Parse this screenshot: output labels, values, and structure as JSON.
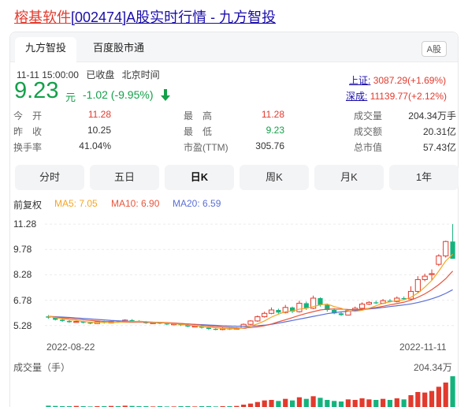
{
  "title": {
    "highlight": "榕基软件",
    "code": "[002474]",
    "rest": "A股实时行情 - 九方智投"
  },
  "tabs": [
    {
      "label": "九方智投",
      "active": true
    },
    {
      "label": "百度股市通",
      "active": false
    }
  ],
  "badge": "A股",
  "status": {
    "time": "11-11 15:00:00",
    "state": "已收盘",
    "zone": "北京时间"
  },
  "quote": {
    "price": "9.23",
    "unit": "元",
    "change": "-1.02 (-9.95%)",
    "color": "#14a04a"
  },
  "indices": [
    {
      "name": "上证:",
      "value": "3087.29(+1.69%)"
    },
    {
      "name": "深成:",
      "value": "11139.77(+2.12%)"
    }
  ],
  "stats": [
    [
      {
        "k": "今　开",
        "v": "11.28",
        "c": "red"
      },
      {
        "k": "最　高",
        "v": "11.28",
        "c": "red"
      },
      {
        "k": "成交量",
        "v": "204.34万手",
        "c": ""
      }
    ],
    [
      {
        "k": "昨　收",
        "v": "10.25",
        "c": ""
      },
      {
        "k": "最　低",
        "v": "9.23",
        "c": "green"
      },
      {
        "k": "成交额",
        "v": "20.31亿",
        "c": ""
      }
    ],
    [
      {
        "k": "换手率",
        "v": "41.04%",
        "c": ""
      },
      {
        "k": "市盈(TTM)",
        "v": "305.76",
        "c": ""
      },
      {
        "k": "总市值",
        "v": "57.43亿",
        "c": ""
      }
    ]
  ],
  "periods": [
    {
      "label": "分时",
      "active": false
    },
    {
      "label": "五日",
      "active": false
    },
    {
      "label": "日K",
      "active": true
    },
    {
      "label": "周K",
      "active": false
    },
    {
      "label": "月K",
      "active": false
    },
    {
      "label": "1年",
      "active": false
    }
  ],
  "ma_legend": {
    "adjust": "前复权",
    "ma5": "MA5: 7.05",
    "ma10": "MA10: 6.90",
    "ma20": "MA20: 6.59"
  },
  "colors": {
    "up": "#e23a2d",
    "down": "#14b37d",
    "ma5": "#f5a623",
    "ma10": "#e8553b",
    "ma20": "#5b6fd6"
  },
  "chart_data": {
    "type": "candlestick",
    "y_ticks": [
      "11.28",
      "9.78",
      "8.28",
      "6.78",
      "5.28"
    ],
    "ylim": [
      4.8,
      11.8
    ],
    "x_start": "2022-08-22",
    "x_end": "2022-11-11",
    "candles": [
      [
        5.82,
        5.75,
        5.9,
        5.68
      ],
      [
        5.75,
        5.62,
        5.8,
        5.58
      ],
      [
        5.62,
        5.55,
        5.68,
        5.5
      ],
      [
        5.55,
        5.48,
        5.6,
        5.44
      ],
      [
        5.48,
        5.52,
        5.58,
        5.45
      ],
      [
        5.52,
        5.45,
        5.56,
        5.4
      ],
      [
        5.45,
        5.4,
        5.5,
        5.36
      ],
      [
        5.4,
        5.5,
        5.55,
        5.38
      ],
      [
        5.5,
        5.44,
        5.56,
        5.4
      ],
      [
        5.44,
        5.52,
        5.58,
        5.42
      ],
      [
        5.52,
        5.48,
        5.58,
        5.44
      ],
      [
        5.48,
        5.6,
        5.65,
        5.46
      ],
      [
        5.6,
        5.55,
        5.66,
        5.5
      ],
      [
        5.55,
        5.5,
        5.6,
        5.46
      ],
      [
        5.5,
        5.42,
        5.55,
        5.38
      ],
      [
        5.42,
        5.45,
        5.5,
        5.38
      ],
      [
        5.45,
        5.4,
        5.5,
        5.36
      ],
      [
        5.4,
        5.35,
        5.45,
        5.3
      ],
      [
        5.35,
        5.38,
        5.42,
        5.3
      ],
      [
        5.38,
        5.3,
        5.42,
        5.25
      ],
      [
        5.3,
        5.22,
        5.35,
        5.18
      ],
      [
        5.22,
        5.25,
        5.3,
        5.18
      ],
      [
        5.25,
        5.15,
        5.28,
        5.1
      ],
      [
        5.15,
        5.08,
        5.2,
        5.02
      ],
      [
        5.08,
        5.05,
        5.12,
        5.0
      ],
      [
        5.05,
        5.1,
        5.15,
        5.0
      ],
      [
        5.1,
        5.08,
        5.15,
        5.02
      ],
      [
        5.08,
        5.12,
        5.18,
        5.04
      ],
      [
        5.12,
        5.35,
        5.4,
        5.1
      ],
      [
        5.35,
        5.55,
        5.6,
        5.3
      ],
      [
        5.55,
        5.8,
        5.88,
        5.5
      ],
      [
        5.8,
        6.0,
        6.1,
        5.75
      ],
      [
        6.0,
        6.2,
        6.35,
        5.95
      ],
      [
        6.2,
        6.05,
        6.28,
        5.98
      ],
      [
        6.05,
        6.35,
        6.5,
        6.0
      ],
      [
        6.35,
        6.1,
        6.4,
        6.02
      ],
      [
        6.1,
        6.6,
        6.75,
        6.05
      ],
      [
        6.6,
        6.3,
        6.7,
        6.2
      ],
      [
        6.3,
        6.9,
        7.05,
        6.25
      ],
      [
        6.9,
        6.5,
        6.95,
        6.4
      ],
      [
        6.5,
        6.2,
        6.58,
        6.1
      ],
      [
        6.2,
        6.0,
        6.3,
        5.95
      ],
      [
        6.0,
        5.9,
        6.1,
        5.85
      ],
      [
        5.9,
        6.15,
        6.25,
        5.88
      ],
      [
        6.15,
        6.3,
        6.4,
        6.1
      ],
      [
        6.3,
        6.55,
        6.65,
        6.25
      ],
      [
        6.55,
        6.65,
        6.72,
        6.5
      ],
      [
        6.65,
        6.6,
        6.75,
        6.55
      ],
      [
        6.6,
        6.75,
        6.85,
        6.55
      ],
      [
        6.75,
        6.7,
        6.85,
        6.65
      ],
      [
        6.7,
        6.9,
        7.0,
        6.65
      ],
      [
        6.9,
        6.85,
        7.0,
        6.8
      ],
      [
        6.85,
        7.3,
        7.6,
        6.8
      ],
      [
        7.3,
        8.0,
        8.2,
        7.2
      ],
      [
        8.0,
        8.2,
        8.35,
        7.9
      ],
      [
        8.3,
        8.35,
        8.6,
        7.95
      ],
      [
        8.9,
        9.4,
        9.5,
        8.8
      ],
      [
        9.4,
        10.25,
        10.3,
        9.3
      ],
      [
        10.25,
        9.23,
        11.28,
        9.23
      ]
    ],
    "ma5": [
      5.82,
      5.75,
      5.68,
      5.62,
      5.58,
      5.52,
      5.48,
      5.47,
      5.47,
      5.47,
      5.47,
      5.5,
      5.52,
      5.53,
      5.51,
      5.48,
      5.46,
      5.42,
      5.39,
      5.35,
      5.3,
      5.27,
      5.22,
      5.18,
      5.14,
      5.1,
      5.09,
      5.09,
      5.15,
      5.24,
      5.38,
      5.55,
      5.78,
      5.95,
      6.1,
      6.14,
      6.25,
      6.3,
      6.4,
      6.5,
      6.55,
      6.4,
      6.3,
      6.15,
      6.12,
      6.18,
      6.3,
      6.45,
      6.6,
      6.68,
      6.75,
      6.8,
      6.95,
      7.2,
      7.55,
      7.95,
      8.5,
      9.1,
      9.5
    ],
    "ma10": [
      5.82,
      5.78,
      5.74,
      5.7,
      5.66,
      5.62,
      5.58,
      5.55,
      5.52,
      5.5,
      5.48,
      5.48,
      5.48,
      5.49,
      5.49,
      5.48,
      5.47,
      5.45,
      5.43,
      5.4,
      5.37,
      5.34,
      5.3,
      5.26,
      5.22,
      5.19,
      5.16,
      5.14,
      5.14,
      5.16,
      5.2,
      5.27,
      5.37,
      5.5,
      5.62,
      5.75,
      5.88,
      6.0,
      6.1,
      6.2,
      6.25,
      6.26,
      6.25,
      6.23,
      6.22,
      6.25,
      6.3,
      6.35,
      6.42,
      6.5,
      6.58,
      6.66,
      6.78,
      6.95,
      7.15,
      7.4,
      7.7,
      8.05,
      8.5
    ],
    "ma20": [
      5.82,
      5.8,
      5.78,
      5.76,
      5.73,
      5.7,
      5.67,
      5.64,
      5.61,
      5.58,
      5.56,
      5.54,
      5.52,
      5.5,
      5.48,
      5.46,
      5.44,
      5.43,
      5.41,
      5.39,
      5.37,
      5.35,
      5.33,
      5.31,
      5.29,
      5.27,
      5.25,
      5.24,
      5.24,
      5.25,
      5.27,
      5.3,
      5.35,
      5.42,
      5.5,
      5.58,
      5.66,
      5.74,
      5.82,
      5.9,
      5.98,
      6.04,
      6.09,
      6.13,
      6.17,
      6.21,
      6.26,
      6.3,
      6.35,
      6.4,
      6.45,
      6.5,
      6.56,
      6.64,
      6.74,
      6.86,
      7.0,
      7.18,
      7.4
    ],
    "volume_label": "成交量（手）",
    "volume_max_label": "204.34万",
    "volume": [
      8,
      7,
      6,
      6,
      7,
      6,
      5,
      6,
      6,
      7,
      6,
      8,
      7,
      6,
      6,
      5,
      6,
      5,
      5,
      6,
      6,
      5,
      6,
      6,
      5,
      6,
      6,
      7,
      12,
      16,
      22,
      28,
      30,
      26,
      34,
      28,
      40,
      34,
      44,
      38,
      30,
      26,
      24,
      32,
      30,
      36,
      32,
      30,
      34,
      30,
      36,
      32,
      48,
      60,
      58,
      64,
      80,
      96,
      120
    ]
  }
}
